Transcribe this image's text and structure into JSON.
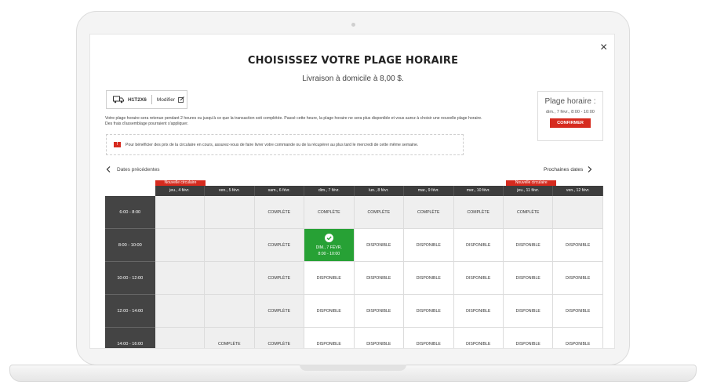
{
  "modal": {
    "title": "CHOISISSEZ VOTRE PLAGE HORAIRE",
    "subtitle": "Livraison à domicile à 8,00 $.",
    "close_label": "×"
  },
  "delivery": {
    "postal_code": "H1T2X6",
    "modify_label": "Modifier"
  },
  "info": {
    "line1": "Votre plage horaire sera retenue pendant 2 heures ou jusqu'à ce que la transaction soit complétée. Passé cette heure, la plage horaire ne sera plus disponible et vous aurez à choisir une nouvelle plage horaire.",
    "line2": "Des frais d'assemblage pourraient s'appliquer."
  },
  "warning": {
    "icon": "!",
    "text": "Pour bénéficier des prix de la circulaire en cours, assurez-vous de faire livrer votre commande ou de la récupérer au plus tard le mercredi de cette même semaine."
  },
  "selection_panel": {
    "title": "Plage horaire :",
    "selected": "dim., 7 févr., 8:00 - 10:00",
    "confirm_label": "CONFIRMER"
  },
  "nav": {
    "prev_label": "Dates précédentes",
    "next_label": "Prochaines dates"
  },
  "badge_label": "Nouvelle circulaire",
  "days": [
    "jeu., 4 févr.",
    "ven., 5 févr.",
    "sam., 6 févr.",
    "dim., 7 févr.",
    "lun., 8 févr.",
    "mar., 9 févr.",
    "mer., 10 févr.",
    "jeu., 11 févr.",
    "ven., 12 févr."
  ],
  "badge_days": [
    0,
    7
  ],
  "slots": [
    {
      "time": "6:00 - 8:00",
      "cells": [
        "",
        "",
        "COMPLÈTE",
        "COMPLÈTE",
        "COMPLÈTE",
        "COMPLÈTE",
        "COMPLÈTE",
        "COMPLÈTE",
        ""
      ]
    },
    {
      "time": "8:00 - 10:00",
      "cells": [
        "",
        "",
        "COMPLÈTE",
        "SELECTED",
        "DISPONIBLE",
        "DISPONIBLE",
        "DISPONIBLE",
        "DISPONIBLE",
        "DISPONIBLE"
      ]
    },
    {
      "time": "10:00 - 12:00",
      "cells": [
        "",
        "",
        "COMPLÈTE",
        "DISPONIBLE",
        "DISPONIBLE",
        "DISPONIBLE",
        "DISPONIBLE",
        "DISPONIBLE",
        "DISPONIBLE"
      ]
    },
    {
      "time": "12:00 - 14:00",
      "cells": [
        "",
        "",
        "COMPLÈTE",
        "DISPONIBLE",
        "DISPONIBLE",
        "DISPONIBLE",
        "DISPONIBLE",
        "DISPONIBLE",
        "DISPONIBLE"
      ]
    },
    {
      "time": "14:00 - 16:00",
      "cells": [
        "",
        "COMPLÈTE",
        "COMPLÈTE",
        "DISPONIBLE",
        "DISPONIBLE",
        "DISPONIBLE",
        "DISPONIBLE",
        "DISPONIBLE",
        "DISPONIBLE"
      ]
    }
  ],
  "selected_cell": {
    "line1": "DIM., 7 FÉVR.",
    "line2": "8:00 - 10:00"
  },
  "colors": {
    "accent": "#d62b1f",
    "selected": "#27a135",
    "header": "#3d3d3d"
  }
}
